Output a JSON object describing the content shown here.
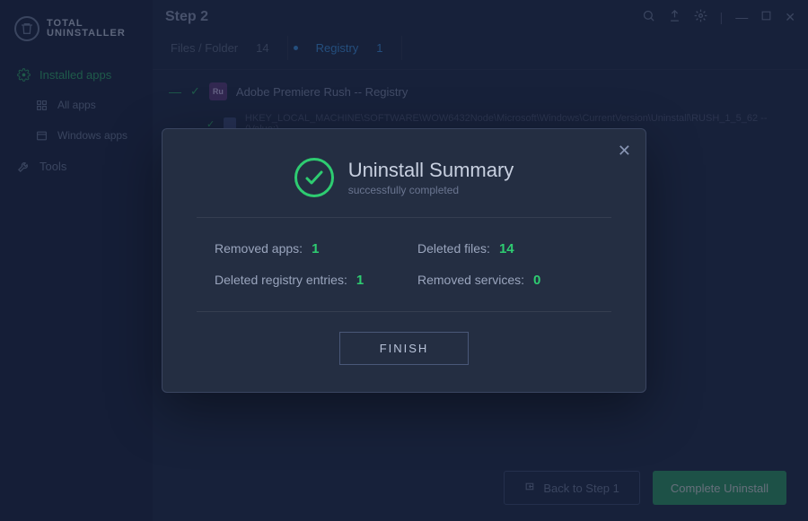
{
  "app": {
    "logo_line1": "TOTAL",
    "logo_line2": "UNINSTALLER"
  },
  "sidebar": {
    "items": [
      {
        "label": "Installed apps",
        "icon": "gear"
      },
      {
        "label": "All apps",
        "icon": "grid"
      },
      {
        "label": "Windows apps",
        "icon": "window"
      },
      {
        "label": "Tools",
        "icon": "wrench"
      }
    ]
  },
  "header": {
    "step_title": "Step 2"
  },
  "tabs": [
    {
      "label": "Files / Folder",
      "count": "14"
    },
    {
      "label": "Registry",
      "count": "1"
    }
  ],
  "registry": {
    "app_icon_text": "Ru",
    "app_name": "Adobe Premiere Rush  --  Registry",
    "entry": "HKEY_LOCAL_MACHINE\\SOFTWARE\\WOW6432Node\\Microsoft\\Windows\\CurrentVersion\\Uninstall\\RUSH_1_5_62  --  (Value:)"
  },
  "footer": {
    "back_label": "Back to Step 1",
    "complete_label": "Complete Uninstall"
  },
  "dialog": {
    "title": "Uninstall Summary",
    "subtitle": "successfully completed",
    "stats": {
      "removed_apps_label": "Removed apps:",
      "removed_apps_value": "1",
      "deleted_files_label": "Deleted files:",
      "deleted_files_value": "14",
      "deleted_registry_label": "Deleted registry entries:",
      "deleted_registry_value": "1",
      "removed_services_label": "Removed services:",
      "removed_services_value": "0"
    },
    "finish_label": "FINISH"
  }
}
